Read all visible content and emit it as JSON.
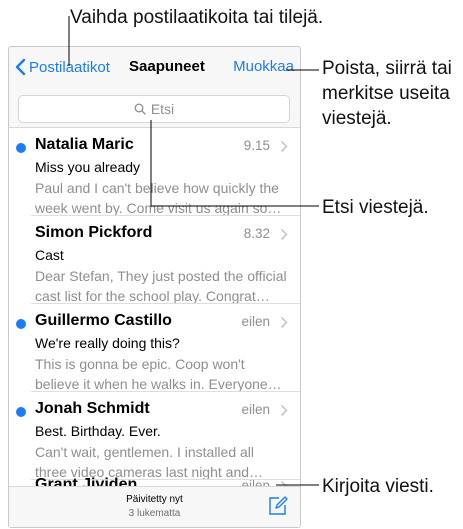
{
  "callouts": {
    "top": "Vaihda postilaatikoita tai tilejä.",
    "edit": [
      "Poista, siirrä tai",
      "merkitse useita",
      "viestejä."
    ],
    "search": "Etsi viestejä.",
    "compose": "Kirjoita viesti."
  },
  "navbar": {
    "back_label": "Postilaatikot",
    "title": "Saapuneet",
    "edit_label": "Muokkaa"
  },
  "search": {
    "placeholder": "Etsi"
  },
  "messages": [
    {
      "sender": "Natalia Maric",
      "time": "9.15",
      "unread": true,
      "subject": "Miss you already",
      "preview": [
        "Paul and I can't believe how quickly the",
        "week went by. Come visit us again so…"
      ]
    },
    {
      "sender": "Simon Pickford",
      "time": "8.32",
      "unread": false,
      "subject": "Cast",
      "preview": [
        "Dear Stefan, They just posted the official",
        "cast list for the school play. Congrat…"
      ]
    },
    {
      "sender": "Guillermo Castillo",
      "time": "eilen",
      "unread": true,
      "subject": "We're really doing this?",
      "preview": [
        "This is gonna be epic. Coop won't",
        "believe it when he walks in. Everyone…"
      ]
    },
    {
      "sender": "Jonah Schmidt",
      "time": "eilen",
      "unread": true,
      "subject": "Best. Birthday. Ever.",
      "preview": [
        "Can't wait, gentlemen. I installed all",
        "three video cameras last night and…"
      ]
    },
    {
      "sender": "Grant Jividen",
      "time": "eilen",
      "unread": false,
      "subject": "",
      "preview": [
        "",
        ""
      ]
    }
  ],
  "toolbar": {
    "status": "Päivitetty nyt",
    "unread_count": "3 lukematta"
  },
  "colors": {
    "accent": "#1a7cf6",
    "unread_dot": "#1a7cf6",
    "secondary_text": "#8e8e93"
  },
  "icons": {
    "back": "chevron-left-icon",
    "search": "magnifier-icon",
    "disclosure": "chevron-right-icon",
    "compose": "compose-icon"
  }
}
